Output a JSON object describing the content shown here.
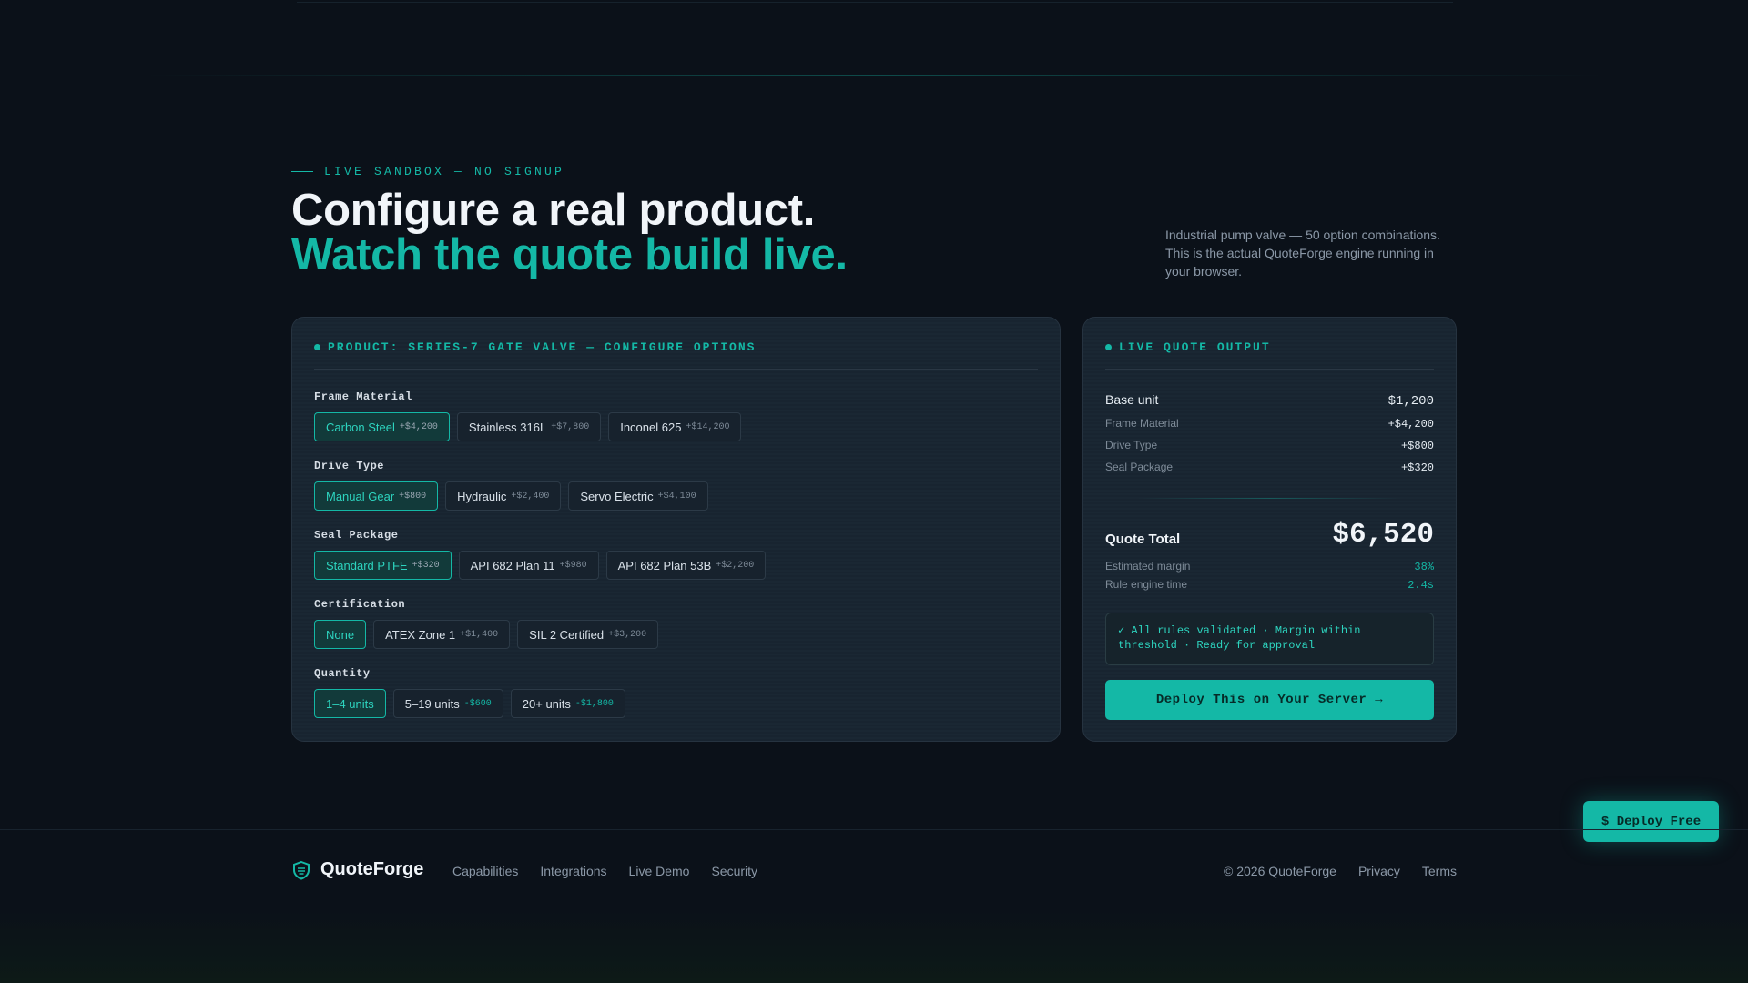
{
  "hero": {
    "eyebrow": "LIVE SANDBOX — NO SIGNUP",
    "title_line1": "Configure a real product.",
    "title_line2": "Watch the quote build live.",
    "intro": "Industrial pump valve — 50 option combinations. This is the actual QuoteForge engine running in your browser."
  },
  "configurator": {
    "title": "PRODUCT: SERIES-7 GATE VALVE — CONFIGURE OPTIONS",
    "groups": [
      {
        "label": "Frame Material",
        "options": [
          {
            "name": "Carbon Steel",
            "delta": "+$4,200",
            "selected": true
          },
          {
            "name": "Stainless 316L",
            "delta": "+$7,800",
            "selected": false
          },
          {
            "name": "Inconel 625",
            "delta": "+$14,200",
            "selected": false
          }
        ]
      },
      {
        "label": "Drive Type",
        "options": [
          {
            "name": "Manual Gear",
            "delta": "+$800",
            "selected": true
          },
          {
            "name": "Hydraulic",
            "delta": "+$2,400",
            "selected": false
          },
          {
            "name": "Servo Electric",
            "delta": "+$4,100",
            "selected": false
          }
        ]
      },
      {
        "label": "Seal Package",
        "options": [
          {
            "name": "Standard PTFE",
            "delta": "+$320",
            "selected": true
          },
          {
            "name": "API 682 Plan 11",
            "delta": "+$980",
            "selected": false
          },
          {
            "name": "API 682 Plan 53B",
            "delta": "+$2,200",
            "selected": false
          }
        ]
      },
      {
        "label": "Certification",
        "options": [
          {
            "name": "None",
            "delta": "",
            "selected": true
          },
          {
            "name": "ATEX Zone 1",
            "delta": "+$1,400",
            "selected": false
          },
          {
            "name": "SIL 2 Certified",
            "delta": "+$3,200",
            "selected": false
          }
        ]
      },
      {
        "label": "Quantity",
        "options": [
          {
            "name": "1–4 units",
            "delta": "",
            "selected": true
          },
          {
            "name": "5–19 units",
            "delta": "-$600",
            "selected": false
          },
          {
            "name": "20+ units",
            "delta": "-$1,800",
            "selected": false
          }
        ]
      }
    ]
  },
  "quote": {
    "title": "LIVE QUOTE OUTPUT",
    "base_label": "Base unit",
    "base_value": "$1,200",
    "lines": [
      {
        "label": "Frame Material",
        "value": "+$4,200"
      },
      {
        "label": "Drive Type",
        "value": "+$800"
      },
      {
        "label": "Seal Package",
        "value": "+$320"
      }
    ],
    "total_label": "Quote Total",
    "total_value": "$6,520",
    "metrics": [
      {
        "label": "Estimated margin",
        "value": "38%"
      },
      {
        "label": "Rule engine time",
        "value": "2.4s"
      }
    ],
    "validation": "✓ All rules validated · Margin within threshold · Ready for approval",
    "deploy_label": "Deploy This on Your Server →"
  },
  "floating_button": "$ Deploy Free",
  "footer": {
    "brand": "QuoteForge",
    "nav": [
      "Capabilities",
      "Integrations",
      "Live Demo",
      "Security"
    ],
    "copyright": "© 2026 QuoteForge",
    "links": [
      "Privacy",
      "Terms"
    ]
  },
  "colors": {
    "accent": "#14b8a6",
    "background": "#0b1119",
    "panel": "#182430"
  }
}
